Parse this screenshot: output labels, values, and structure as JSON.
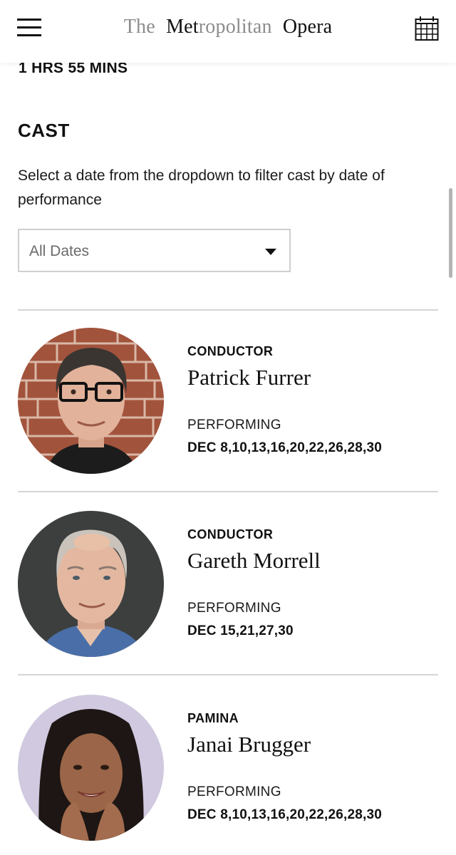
{
  "header": {
    "logo_parts": [
      "The",
      "Met",
      "ropolitan",
      "Opera"
    ],
    "menu_icon": "hamburger-menu-icon",
    "calendar_icon": "calendar-icon"
  },
  "production": {
    "duration": "1 HRS 55 MINS"
  },
  "cast_section": {
    "heading": "CAST",
    "instruction": "Select a date from the dropdown to filter cast by date of performance",
    "date_filter": {
      "selected": "All Dates"
    }
  },
  "cast": [
    {
      "role": "CONDUCTOR",
      "name": "Patrick Furrer",
      "performing_label": "PERFORMING",
      "dates": "DEC 8,10,13,16,20,22,26,28,30"
    },
    {
      "role": "CONDUCTOR",
      "name": "Gareth Morrell",
      "performing_label": "PERFORMING",
      "dates": "DEC 15,21,27,30"
    },
    {
      "role": "PAMINA",
      "name": "Janai Brugger",
      "performing_label": "PERFORMING",
      "dates": "DEC 8,10,13,16,20,22,26,28,30"
    }
  ],
  "colors": {
    "text": "#111111",
    "muted": "#8c8c8c",
    "divider": "#d6d6d6",
    "select_border": "#cfcfcf"
  }
}
